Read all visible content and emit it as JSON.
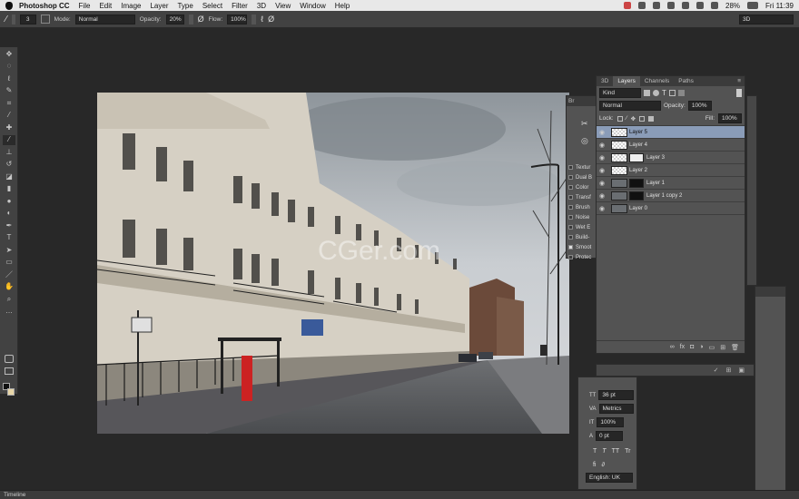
{
  "menubar": {
    "app": "Photoshop CC",
    "items": [
      "File",
      "Edit",
      "Image",
      "Layer",
      "Type",
      "Select",
      "Filter",
      "3D",
      "View",
      "Window",
      "Help"
    ],
    "battery": "28%",
    "clock": "Fri 11:39"
  },
  "options_bar": {
    "brush_size": "3",
    "mode_label": "Mode:",
    "mode_value": "Normal",
    "opacity_label": "Opacity:",
    "opacity_value": "20%",
    "flow_label": "Flow:",
    "flow_value": "100%",
    "workspace": "3D"
  },
  "layers_panel": {
    "tabs": [
      "3D",
      "Layers",
      "Channels",
      "Paths"
    ],
    "filter_kind": "Kind",
    "blend_mode": "Normal",
    "opacity_label": "Opacity:",
    "opacity_value": "100%",
    "lock_label": "Lock:",
    "fill_label": "Fill:",
    "fill_value": "100%",
    "layers": [
      {
        "name": "Layer 5",
        "selected": true
      },
      {
        "name": "Layer 4"
      },
      {
        "name": "Layer 3"
      },
      {
        "name": "Layer 2"
      },
      {
        "name": "Layer 1"
      },
      {
        "name": "Layer 1 copy 2"
      },
      {
        "name": "Layer 0"
      }
    ]
  },
  "brush_panel": {
    "options": [
      "Textur",
      "Dual B",
      "Color",
      "Transf",
      "Brush",
      "Noise",
      "Wet E",
      "Build-",
      "Smoot",
      "Protec"
    ]
  },
  "character_panel": {
    "size": "36 pt",
    "kerning": "Metrics",
    "scale": "100%",
    "baseline": "0 pt",
    "type_buttons": [
      "T",
      "T",
      "TT",
      "Tr"
    ],
    "language": "English: UK"
  },
  "canvas": {
    "watermark": "CGer.com"
  },
  "status": {
    "timeline": "Timeline"
  }
}
